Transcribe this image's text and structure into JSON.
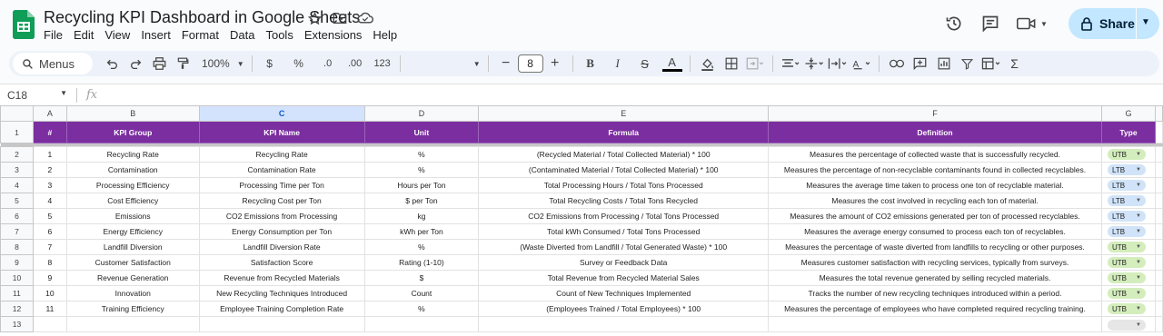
{
  "doc": {
    "title": "Recycling KPI Dashboard in Google Sheets",
    "menu": [
      "File",
      "Edit",
      "View",
      "Insert",
      "Format",
      "Data",
      "Tools",
      "Extensions",
      "Help"
    ],
    "share_label": "Share"
  },
  "toolbar": {
    "menus_label": "Menus",
    "zoom": "100%",
    "currency": "$",
    "percent": "%",
    "decrease_decimal": ".0",
    "increase_decimal": ".00",
    "number_format": "123",
    "font_size": "8"
  },
  "formula_bar": {
    "cell_ref": "C18",
    "fx": "fx"
  },
  "columns": [
    "A",
    "B",
    "C",
    "D",
    "E",
    "F",
    "G"
  ],
  "selected_column": "C",
  "header_row": {
    "number": "1",
    "cells": [
      "#",
      "KPI Group",
      "KPI Name",
      "Unit",
      "Formula",
      "Definition",
      "Type"
    ]
  },
  "rows": [
    {
      "row": "2",
      "n": "1",
      "group": "Recycling Rate",
      "name": "Recycling Rate",
      "unit": "%",
      "formula": "(Recycled Material / Total Collected Material) * 100",
      "definition": "Measures the percentage of collected waste that is successfully recycled.",
      "type": "UTB"
    },
    {
      "row": "3",
      "n": "2",
      "group": "Contamination",
      "name": "Contamination Rate",
      "unit": "%",
      "formula": "(Contaminated Material / Total Collected Material) * 100",
      "definition": "Measures the percentage of non-recyclable contaminants found in collected recyclables.",
      "type": "LTB"
    },
    {
      "row": "4",
      "n": "3",
      "group": "Processing Efficiency",
      "name": "Processing Time per Ton",
      "unit": "Hours per Ton",
      "formula": "Total Processing Hours / Total Tons Processed",
      "definition": "Measures the average time taken to process one ton of recyclable material.",
      "type": "LTB"
    },
    {
      "row": "5",
      "n": "4",
      "group": "Cost Efficiency",
      "name": "Recycling Cost per Ton",
      "unit": "$ per Ton",
      "formula": "Total Recycling Costs / Total Tons Recycled",
      "definition": "Measures the cost involved in recycling each ton of material.",
      "type": "LTB"
    },
    {
      "row": "6",
      "n": "5",
      "group": "Emissions",
      "name": "CO2 Emissions from Processing",
      "unit": "kg",
      "formula": "CO2 Emissions from Processing / Total Tons Processed",
      "definition": "Measures the amount of CO2 emissions generated per ton of processed recyclables.",
      "type": "LTB"
    },
    {
      "row": "7",
      "n": "6",
      "group": "Energy Efficiency",
      "name": "Energy Consumption per Ton",
      "unit": "kWh per Ton",
      "formula": "Total kWh Consumed / Total Tons Processed",
      "definition": "Measures the average energy consumed to process each ton of recyclables.",
      "type": "LTB"
    },
    {
      "row": "8",
      "n": "7",
      "group": "Landfill Diversion",
      "name": "Landfill Diversion Rate",
      "unit": "%",
      "formula": "(Waste Diverted from Landfill / Total Generated Waste) * 100",
      "definition": "Measures the percentage of waste diverted from landfills to recycling or other purposes.",
      "type": "UTB"
    },
    {
      "row": "9",
      "n": "8",
      "group": "Customer Satisfaction",
      "name": "Satisfaction Score",
      "unit": "Rating (1-10)",
      "formula": "Survey or Feedback Data",
      "definition": "Measures customer satisfaction with recycling services, typically from surveys.",
      "type": "UTB"
    },
    {
      "row": "10",
      "n": "9",
      "group": "Revenue Generation",
      "name": "Revenue from Recycled Materials",
      "unit": "$",
      "formula": "Total Revenue from Recycled Material Sales",
      "definition": "Measures the total revenue generated by selling recycled materials.",
      "type": "UTB"
    },
    {
      "row": "11",
      "n": "10",
      "group": "Innovation",
      "name": "New Recycling Techniques Introduced",
      "unit": "Count",
      "formula": "Count of New Techniques Implemented",
      "definition": "Tracks the number of new recycling techniques introduced within a period.",
      "type": "UTB"
    },
    {
      "row": "12",
      "n": "11",
      "group": "Training Efficiency",
      "name": "Employee Training Completion Rate",
      "unit": "%",
      "formula": "(Employees Trained / Total Employees) * 100",
      "definition": "Measures the percentage of employees who have completed required recycling training.",
      "type": "UTB"
    },
    {
      "row": "13",
      "n": "",
      "group": "",
      "name": "",
      "unit": "",
      "formula": "",
      "definition": "",
      "type": ""
    }
  ],
  "colors": {
    "header_bg": "#7b2ea0",
    "utb_chip": "#d4edbc",
    "ltb_chip": "#d0e3f8",
    "share_bg": "#c2e7ff",
    "sheets_green": "#0f9d58"
  }
}
